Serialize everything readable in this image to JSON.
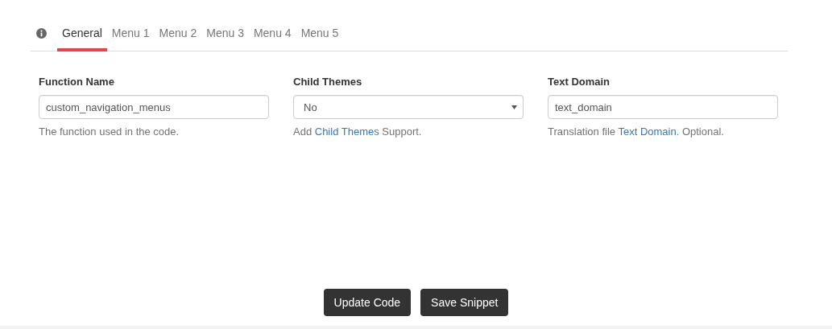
{
  "tabs": [
    {
      "label": "General",
      "selected": true
    },
    {
      "label": "Menu 1",
      "selected": false
    },
    {
      "label": "Menu 2",
      "selected": false
    },
    {
      "label": "Menu 3",
      "selected": false
    },
    {
      "label": "Menu 4",
      "selected": false
    },
    {
      "label": "Menu 5",
      "selected": false
    }
  ],
  "fields": [
    {
      "kind": "input",
      "label": "Function Name",
      "value": "custom_navigation_menus",
      "help": {
        "before": "The function used in the code."
      }
    },
    {
      "kind": "select",
      "label": "Child Themes",
      "value": "No",
      "help": {
        "before": "Add ",
        "link": "Child Themes",
        "after": " Support."
      }
    },
    {
      "kind": "input",
      "label": "Text Domain",
      "value": "text_domain",
      "help": {
        "before": "Translation file ",
        "link": "Text Domain",
        "after": ". Optional."
      }
    }
  ],
  "buttons": [
    "Update Code",
    "Save Snippet"
  ]
}
